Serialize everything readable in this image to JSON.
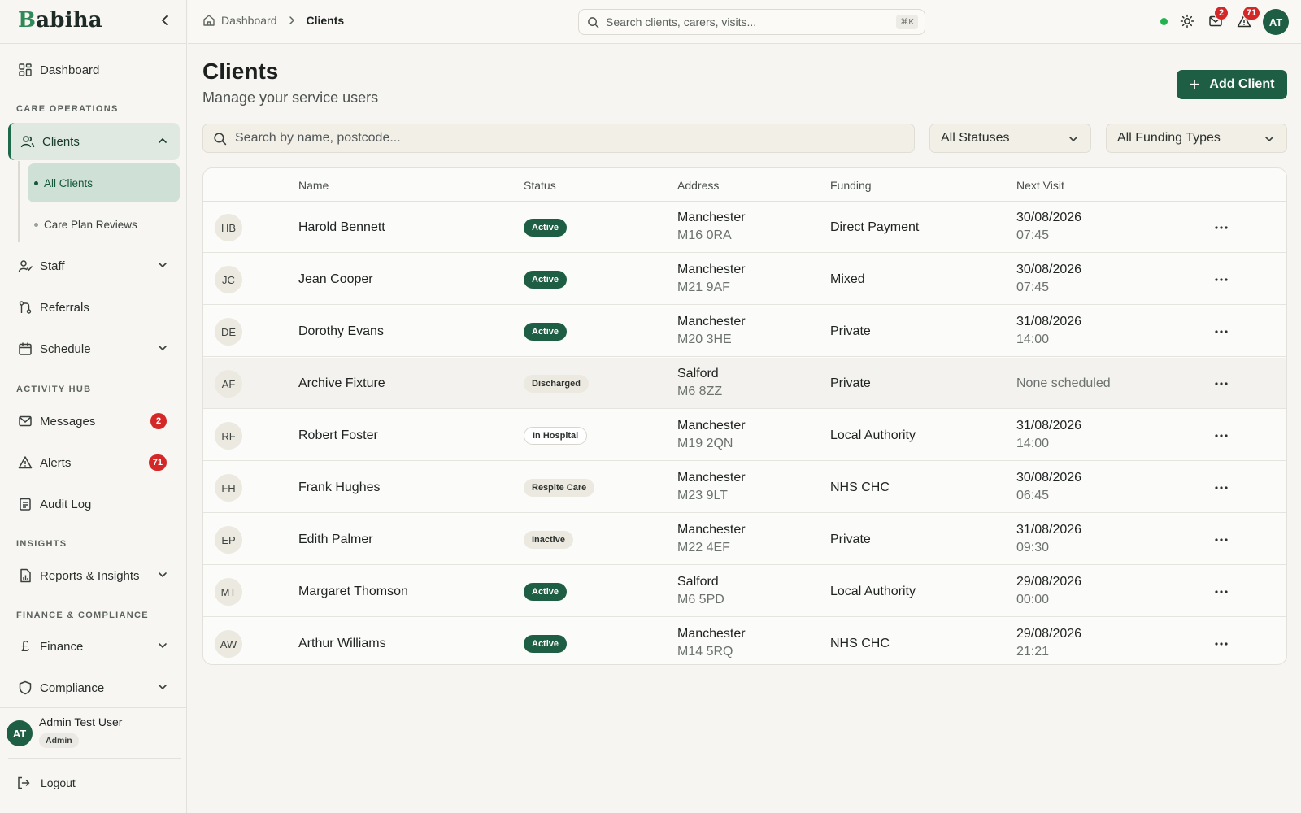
{
  "brand": {
    "first": "B",
    "rest": "abiha"
  },
  "sidebar": {
    "dashboard": "Dashboard",
    "sections": {
      "care": "CARE OPERATIONS",
      "activity": "ACTIVITY HUB",
      "insights": "INSIGHTS",
      "finance": "FINANCE & COMPLIANCE"
    },
    "clients": "Clients",
    "sub": {
      "all": "All Clients",
      "reviews": "Care Plan Reviews"
    },
    "staff": "Staff",
    "referrals": "Referrals",
    "schedule": "Schedule",
    "messages": "Messages",
    "messages_badge": "2",
    "alerts": "Alerts",
    "alerts_badge": "71",
    "audit": "Audit Log",
    "reports": "Reports & Insights",
    "finance": "Finance",
    "compliance": "Compliance",
    "user": {
      "initials": "AT",
      "name": "Admin Test User",
      "role": "Admin"
    },
    "logout": "Logout"
  },
  "topbar": {
    "crumb_home": "Dashboard",
    "crumb_current": "Clients",
    "search_placeholder": "Search clients, carers, visits...",
    "shortcut": "⌘K",
    "messages_badge": "2",
    "alerts_badge": "71",
    "avatar": "AT"
  },
  "page": {
    "title": "Clients",
    "subtitle": "Manage your service users",
    "add_label": "Add Client",
    "search_placeholder": "Search by name, postcode...",
    "status_filter": "All Statuses",
    "funding_filter": "All Funding Types"
  },
  "table": {
    "headers": {
      "name": "Name",
      "status": "Status",
      "address": "Address",
      "funding": "Funding",
      "visit": "Next Visit"
    },
    "rows": [
      {
        "initials": "HB",
        "name": "Harold Bennett",
        "status": "Active",
        "city": "Manchester",
        "postcode": "M16 0RA",
        "funding": "Direct Payment",
        "date": "30/08/2026",
        "time": "07:45"
      },
      {
        "initials": "JC",
        "name": "Jean Cooper",
        "status": "Active",
        "city": "Manchester",
        "postcode": "M21 9AF",
        "funding": "Mixed",
        "date": "30/08/2026",
        "time": "07:45"
      },
      {
        "initials": "DE",
        "name": "Dorothy Evans",
        "status": "Active",
        "city": "Manchester",
        "postcode": "M20 3HE",
        "funding": "Private",
        "date": "31/08/2026",
        "time": "14:00"
      },
      {
        "initials": "AF",
        "name": "Archive Fixture",
        "status": "Discharged",
        "city": "Salford",
        "postcode": "M6 8ZZ",
        "funding": "Private",
        "none": "None scheduled"
      },
      {
        "initials": "RF",
        "name": "Robert Foster",
        "status": "In Hospital",
        "city": "Manchester",
        "postcode": "M19 2QN",
        "funding": "Local Authority",
        "date": "31/08/2026",
        "time": "14:00"
      },
      {
        "initials": "FH",
        "name": "Frank Hughes",
        "status": "Respite Care",
        "city": "Manchester",
        "postcode": "M23 9LT",
        "funding": "NHS CHC",
        "date": "30/08/2026",
        "time": "06:45"
      },
      {
        "initials": "EP",
        "name": "Edith Palmer",
        "status": "Inactive",
        "city": "Manchester",
        "postcode": "M22 4EF",
        "funding": "Private",
        "date": "31/08/2026",
        "time": "09:30"
      },
      {
        "initials": "MT",
        "name": "Margaret Thomson",
        "status": "Active",
        "city": "Salford",
        "postcode": "M6 5PD",
        "funding": "Local Authority",
        "date": "29/08/2026",
        "time": "00:00"
      },
      {
        "initials": "AW",
        "name": "Arthur Williams",
        "status": "Active",
        "city": "Manchester",
        "postcode": "M14 5RQ",
        "funding": "NHS CHC",
        "date": "29/08/2026",
        "time": "21:21"
      }
    ]
  }
}
